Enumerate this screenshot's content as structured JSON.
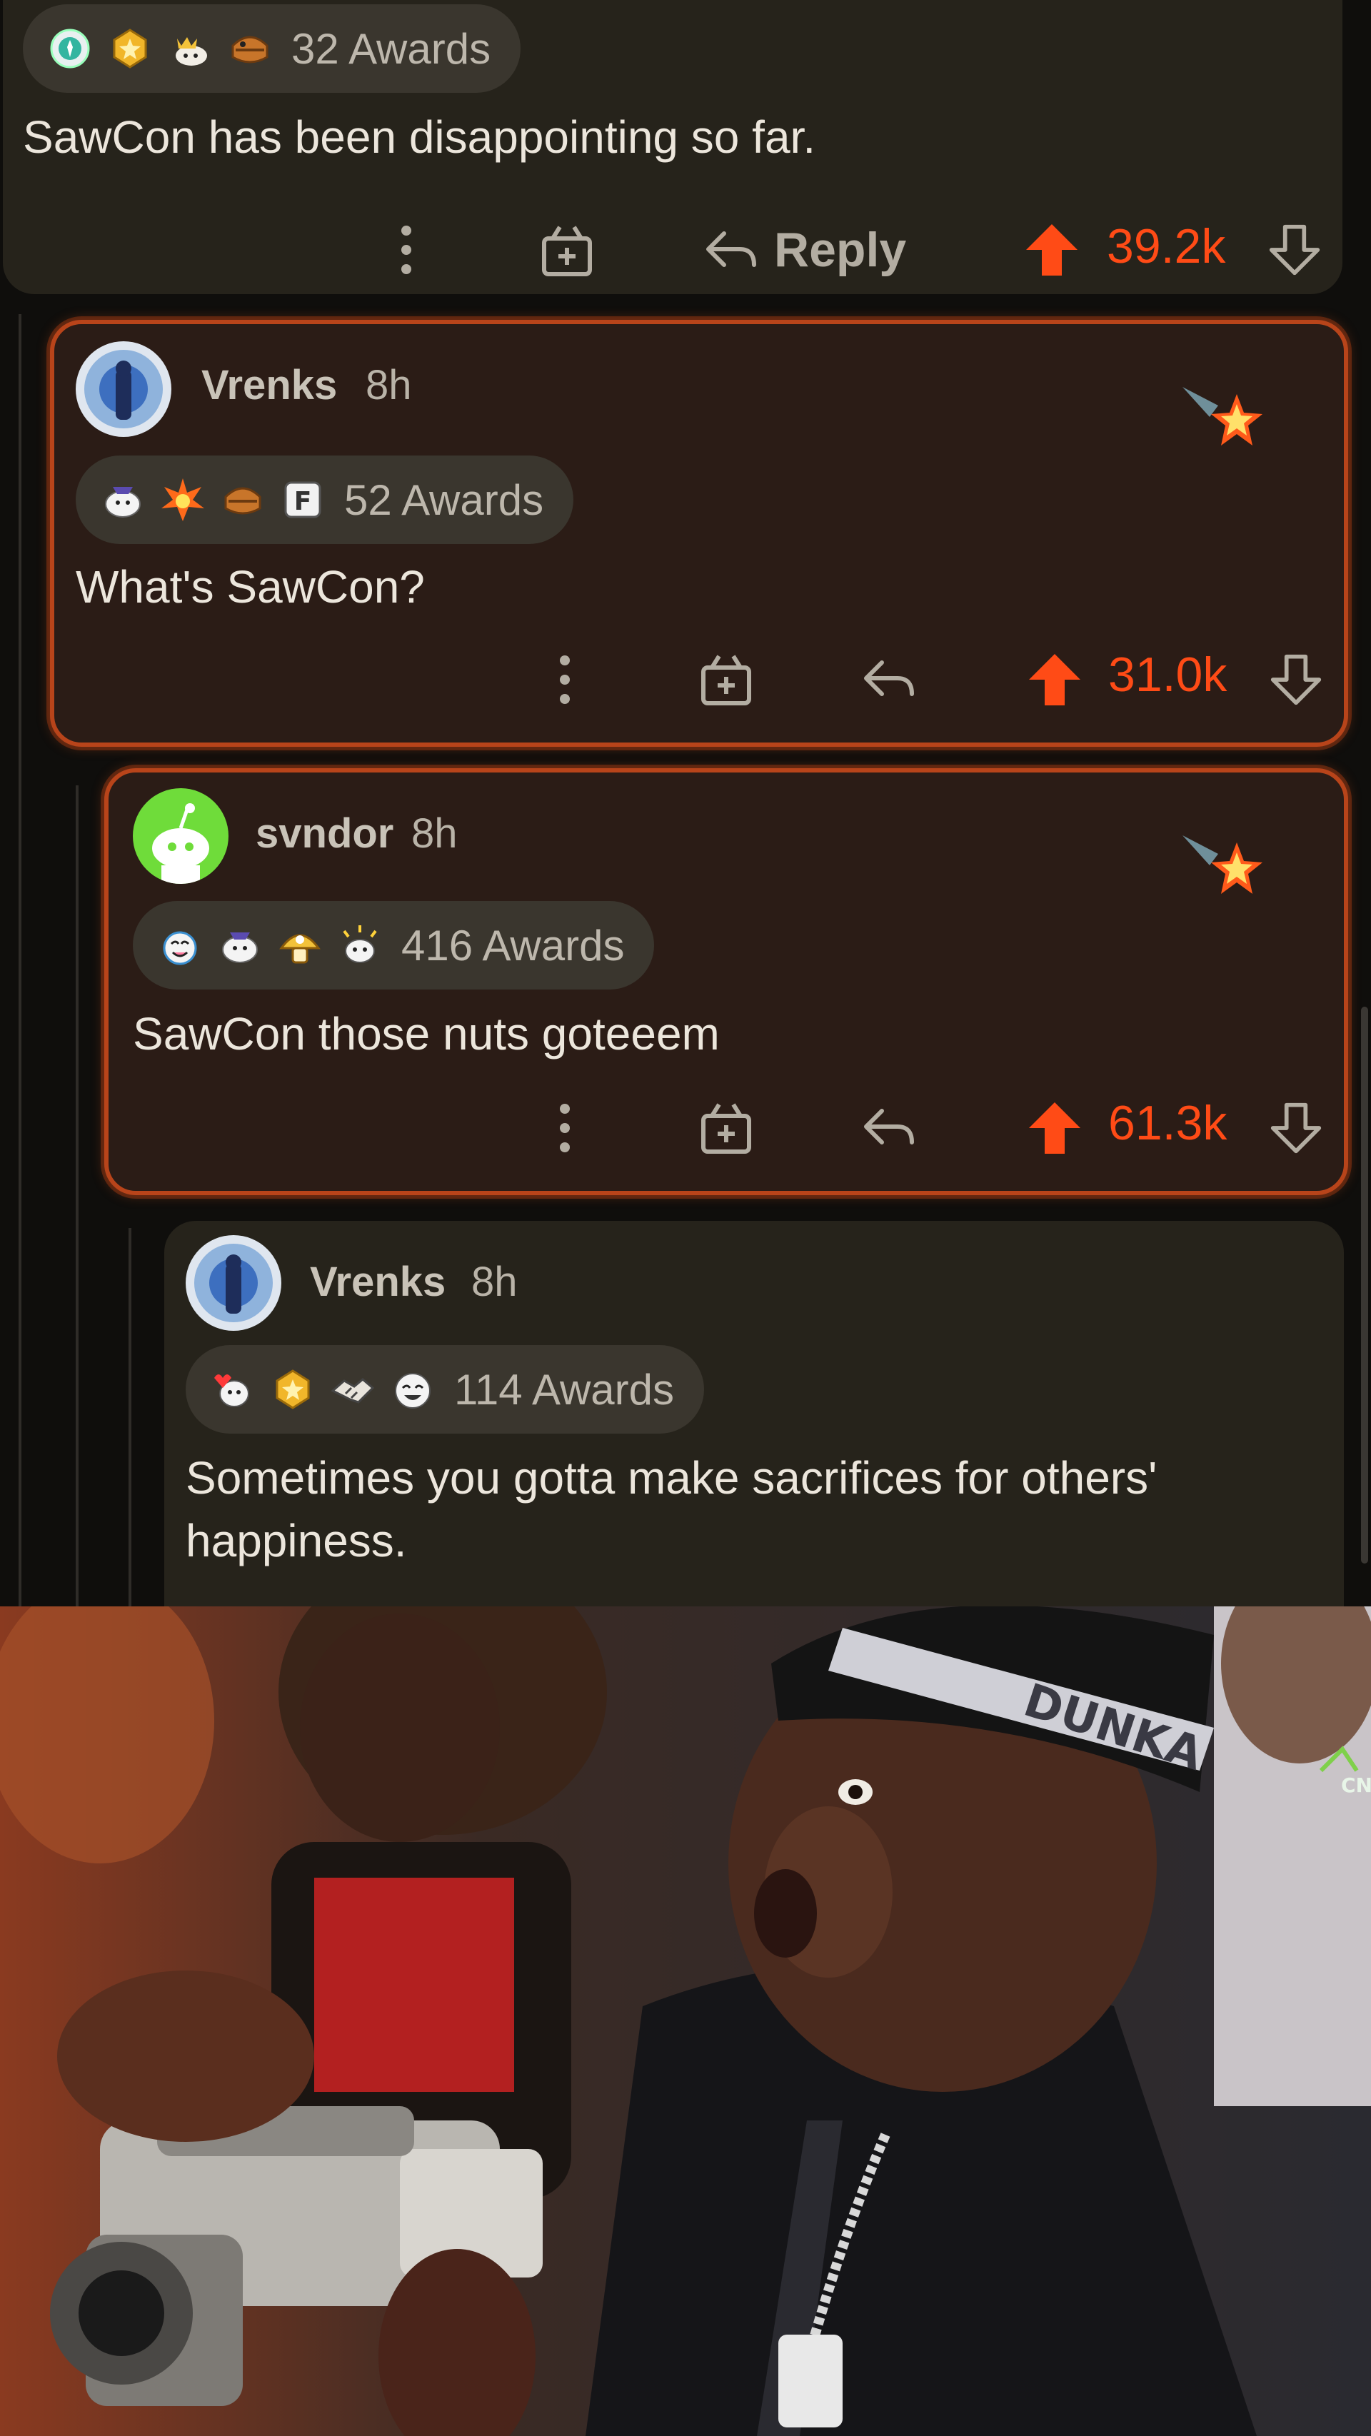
{
  "top_comment": {
    "awards": {
      "icons": [
        "crypto-medallion-award",
        "gold-badge-award",
        "crown-cat-award",
        "bread-treasure-award"
      ],
      "count": "32 Awards"
    },
    "body": "SawCon has been disappointing so far.",
    "reply_label": "Reply",
    "score": "39.2k"
  },
  "reply_1": {
    "username": "Vrenks",
    "time": "8h",
    "awards": {
      "icons": [
        "wholesome-seal-award",
        "starstruck-burst-award",
        "bread-treasure-award",
        "press-f-award"
      ],
      "count": "52 Awards"
    },
    "body": "What's SawCon?",
    "score": "31.0k"
  },
  "reply_2": {
    "username": "svndor",
    "time": "8h",
    "awards": {
      "icons": [
        "wholesome-award",
        "wholesome-seal-award",
        "gold-mushroom-award",
        "party-snoo-award"
      ],
      "count": "416 Awards"
    },
    "body": "SawCon those nuts goteeem",
    "score": "61.3k"
  },
  "reply_3": {
    "username": "Vrenks",
    "time": "8h",
    "awards": {
      "icons": [
        "heartwarming-award",
        "gold-badge-award",
        "handshake-award",
        "laughing-award"
      ],
      "count": "114 Awards"
    },
    "body": "Sometimes you gotta make sacrifices for others' happiness."
  },
  "meme_image": {
    "description_icon": "reaction-photo",
    "headband_text": "DUNKA",
    "corner_logo": "CN"
  },
  "colors": {
    "background": "#0f0e0c",
    "card": "#26231b",
    "highlight_card": "#2b1c16",
    "highlight_border": "#b8441a",
    "upvote_orange": "#ff4b16",
    "muted_text": "#b3ada2"
  }
}
